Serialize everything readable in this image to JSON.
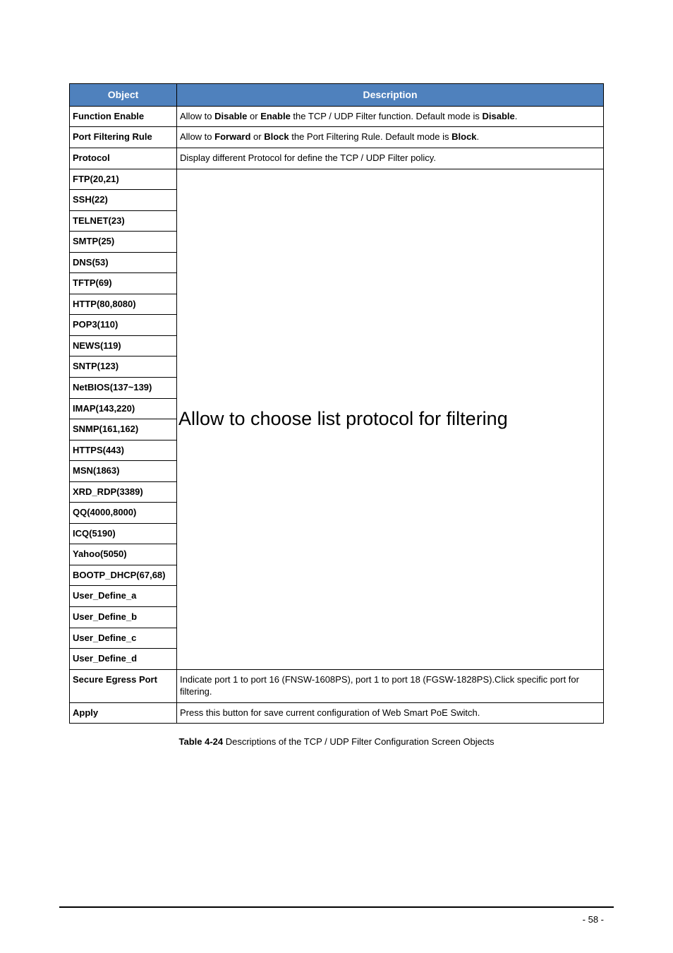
{
  "header": {
    "object": "Object",
    "description": "Description"
  },
  "rows_top": [
    {
      "obj": "Function Enable",
      "desc_parts": [
        "Allow to ",
        "Disable",
        " or ",
        "Enable",
        " the TCP / UDP Filter function. Default mode is ",
        "Disable",
        "."
      ],
      "bold_idx": [
        1,
        3,
        5
      ]
    },
    {
      "obj": "Port Filtering Rule",
      "desc_parts": [
        "Allow to ",
        "Forward",
        " or ",
        "Block",
        " the Port Filtering Rule. Default mode is ",
        "Block",
        "."
      ],
      "bold_idx": [
        1,
        3,
        5
      ]
    },
    {
      "obj": "Protocol",
      "desc_parts": [
        "Display different Protocol for define the TCP / UDP Filter policy."
      ],
      "bold_idx": []
    }
  ],
  "protocol_list": [
    "FTP(20,21)",
    "SSH(22)",
    "TELNET(23)",
    "SMTP(25)",
    "DNS(53)",
    "TFTP(69)",
    "HTTP(80,8080)",
    "POP3(110)",
    "NEWS(119)",
    "SNTP(123)",
    "NetBIOS(137~139)",
    "IMAP(143,220)",
    "SNMP(161,162)",
    "HTTPS(443)",
    "MSN(1863)",
    "XRD_RDP(3389)",
    "QQ(4000,8000)",
    "ICQ(5190)",
    "Yahoo(5050)",
    "BOOTP_DHCP(67,68)",
    "User_Define_a",
    "User_Define_b",
    "User_Define_c",
    "User_Define_d"
  ],
  "protocol_desc": "Allow to choose list protocol for filtering",
  "rows_bottom": [
    {
      "obj": "Secure Egress Port",
      "desc": "Indicate port 1 to port 16 (FNSW-1608PS),  port 1 to port 18 (FGSW-1828PS).Click specific port for filtering."
    },
    {
      "obj": "Apply",
      "desc": "Press this button for save current configuration of Web Smart PoE Switch."
    }
  ],
  "caption": {
    "bold": "Table 4-24",
    "rest": " Descriptions of the TCP / UDP Filter Configuration Screen Objects"
  },
  "page_number": "- 58 -"
}
